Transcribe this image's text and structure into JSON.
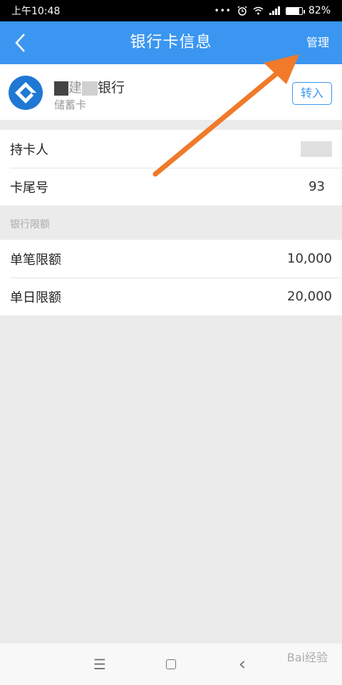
{
  "status_bar": {
    "time": "上午10:48",
    "dots": "•••",
    "battery": "82%",
    "battery_level": 0.82
  },
  "header": {
    "title": "银行卡信息",
    "manage_label": "管理"
  },
  "bank": {
    "name_suffix": "银行",
    "name_mid": "建",
    "card_type": "储蓄卡",
    "transfer_label": "转入"
  },
  "card_info": {
    "holder_label": "持卡人",
    "tail_label": "卡尾号",
    "tail_value": "93"
  },
  "limits": {
    "section_label": "银行限额",
    "single_label": "单笔限额",
    "single_value": "10,000",
    "daily_label": "单日限额",
    "daily_value": "20,000"
  },
  "softkeys": {
    "menu": "☰",
    "back": "‹"
  },
  "watermark": "Bai经验",
  "colors": {
    "primary": "#3a96f0",
    "arrow": "#f07a2a",
    "bank_logo": "#1f78d4"
  },
  "icons": [
    "back-arrow-icon",
    "alarm-icon",
    "wifi-icon",
    "signal-icon",
    "battery-icon",
    "bank-logo-icon",
    "menu-icon",
    "home-icon",
    "back-icon"
  ]
}
